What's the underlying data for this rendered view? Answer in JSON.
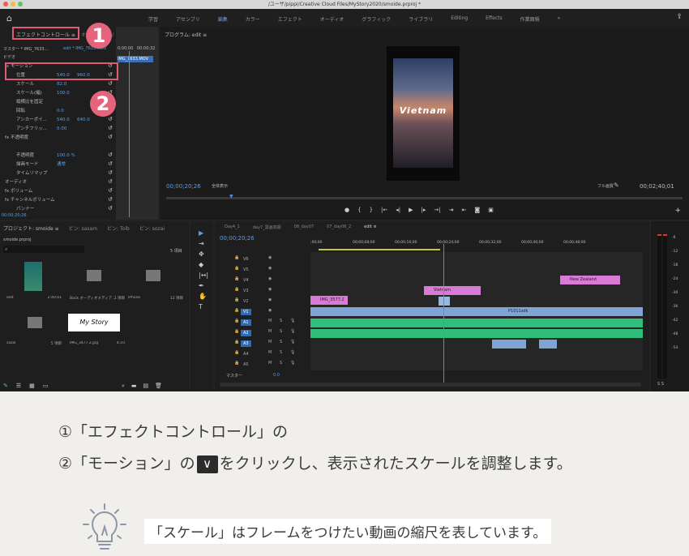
{
  "window": {
    "title": "/ユーザ/pippi/Creative Cloud Files/MyStory2020/smoide.prproj *"
  },
  "workspace": {
    "tabs": [
      "学習",
      "アセンブリ",
      "編集",
      "カラー",
      "エフェクト",
      "オーディオ",
      "グラフィック",
      "ライブラリ",
      "Editing",
      "Effects",
      "作業面積"
    ],
    "active": "編集",
    "more": "»"
  },
  "effect_controls": {
    "tab": "エフェクトコントロール ≡",
    "tab2": "オーディオクリップミキサー",
    "master": "マスター * IMG_7633...",
    "clip": "edit * IMG_7633.MOV",
    "mini_clip": "IMG_7633.MOV",
    "time_a": "0;00;00",
    "time_b": "00;00;32",
    "video_label": "ビデオ",
    "rows": [
      {
        "label": "fx モーション",
        "value": "",
        "value2": ""
      },
      {
        "label": "位置",
        "value": "540.0",
        "value2": "960.0"
      },
      {
        "label": "スケール",
        "value": "82.0",
        "value2": ""
      },
      {
        "label": "スケール(幅)",
        "value": "100.0",
        "value2": ""
      },
      {
        "label": "縦横比を固定",
        "value": "",
        "value2": ""
      },
      {
        "label": "回転",
        "value": "0.0",
        "value2": ""
      },
      {
        "label": "アンカーポイ...",
        "value": "540.0",
        "value2": "640.0"
      },
      {
        "label": "アンチフリッ...",
        "value": "0.00",
        "value2": ""
      },
      {
        "label": "fx 不透明度",
        "value": "",
        "value2": ""
      },
      {
        "label": "",
        "value": "",
        "value2": ""
      },
      {
        "label": "不透明度",
        "value": "100.0 %",
        "value2": ""
      },
      {
        "label": "描画モード",
        "value": "通常",
        "value2": ""
      },
      {
        "label": "タイムリマップ",
        "value": "",
        "value2": ""
      },
      {
        "label": "オーディオ",
        "value": "",
        "value2": ""
      },
      {
        "label": "fx ボリューム",
        "value": "",
        "value2": ""
      },
      {
        "label": "fx チャンネルボリューム",
        "value": "",
        "value2": ""
      },
      {
        "label": "パンナー",
        "value": "",
        "value2": ""
      }
    ],
    "timecode": "00;00;20;26"
  },
  "program": {
    "tab": "プログラム: edit ≡",
    "video_title": "Vietnam",
    "timecode": "00;00;20;26",
    "fit": "全体表示",
    "quality": "フル画質",
    "duration": "00;02;40;01"
  },
  "project": {
    "tabs": [
      "プロジェクト: smoide ≡",
      "ビン: sasam",
      "ビン: Tolb",
      "ビン: sozai"
    ],
    "file": "smoide.prproj",
    "count": "5 項目",
    "items": [
      {
        "name": "edit",
        "meta": "2;40;01"
      },
      {
        "name": "Back オーディオメディア...",
        "meta": "1 項目"
      },
      {
        "name": "iPhone",
        "meta": "12 項目"
      },
      {
        "name": "sozai",
        "meta": "5 項目"
      },
      {
        "name": "IMG_3477.2.jpg",
        "meta": "4;10"
      }
    ],
    "thumb_text": "My Story"
  },
  "timeline": {
    "tabs": [
      "Day4_1",
      "day7_黒画収録",
      "08_day07",
      "07_day06_2",
      "edit ≡"
    ],
    "timecode": "00;00;20;26",
    "ruler": [
      ";00;00",
      "00;00;08;00",
      "00;00;16;00",
      "00;00;24;00",
      "00;00;32;00",
      "00;00;40;00",
      "00;00;48;00"
    ],
    "video_tracks": [
      "V6",
      "V5",
      "V4",
      "V3",
      "V2",
      "V1"
    ],
    "audio_tracks": [
      "A1",
      "A2",
      "A3",
      "A4",
      "A5"
    ],
    "master": "マスター",
    "master_val": "0.0",
    "clips": {
      "vietnam": "Vietnam",
      "nz": "New Zealand",
      "img": "IMG_3577.2",
      "p": "P1011sdk"
    }
  },
  "meter": {
    "labels": [
      "-6",
      "-12",
      "-18",
      "-24",
      "-30",
      "-36",
      "-42",
      "-48",
      "-54"
    ],
    "foot": "S S"
  },
  "annotations": {
    "one": "1",
    "two": "2"
  },
  "instructions": {
    "line1": "①「エフェクトコントロール」の",
    "line2a": "②「モーション」の",
    "chevron": "∨",
    "line2b": "をクリックし、表示されたスケールを調整します。",
    "tip": "「スケール」はフレームをつけたい動画の縮尺を表しています。"
  },
  "colors": {
    "accent": "#e5647c",
    "blue": "#5b9ee9",
    "pink_clip": "#d97ad6",
    "green_audio": "#2fbf7a"
  }
}
